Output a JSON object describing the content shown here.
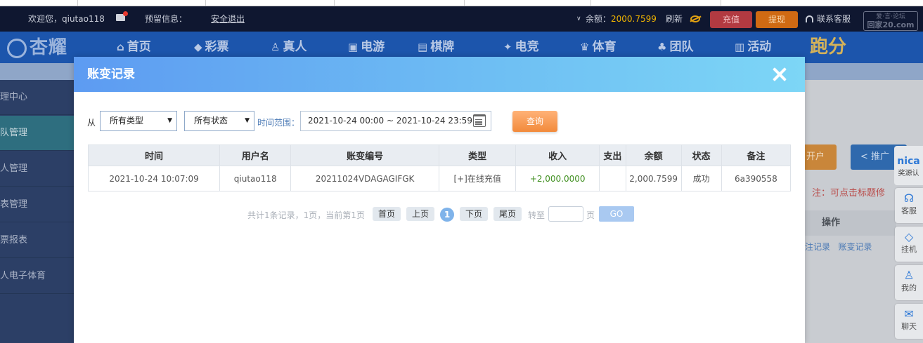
{
  "topbar": {
    "welcome": "欢迎您，qiutao118",
    "notice_label": "预留信息：",
    "logout": "安全退出",
    "balance_label": "余额：",
    "balance_value": "2000.7599",
    "refresh": "刷新",
    "recharge": "充值",
    "withdraw": "提现",
    "support": "联系客服",
    "watermark_line1": "爱·言·论坛",
    "watermark_line2": "回家20.com"
  },
  "brand": {
    "logo": "杏耀"
  },
  "nav": {
    "items": [
      {
        "icon": "home-icon",
        "glyph": "⌂",
        "label": "首页"
      },
      {
        "icon": "lottery-icon",
        "glyph": "◆",
        "label": "彩票"
      },
      {
        "icon": "live-icon",
        "glyph": "♙",
        "label": "真人"
      },
      {
        "icon": "slot-icon",
        "glyph": "▣",
        "label": "电游"
      },
      {
        "icon": "chess-icon",
        "glyph": "▤",
        "label": "棋牌"
      },
      {
        "icon": "esports-icon",
        "glyph": "✦",
        "label": "电竞"
      },
      {
        "icon": "sports-icon",
        "glyph": "♛",
        "label": "体育"
      },
      {
        "icon": "team-icon",
        "glyph": "♣",
        "label": "团队"
      },
      {
        "icon": "activity-icon",
        "glyph": "▥",
        "label": "活动"
      }
    ],
    "extra": "跑分"
  },
  "sidebar": {
    "items": [
      {
        "label": "理中心"
      },
      {
        "label": "队管理"
      },
      {
        "label": "人管理"
      },
      {
        "label": "表管理"
      },
      {
        "label": "票报表"
      },
      {
        "label": "人电子体育"
      }
    ]
  },
  "background": {
    "open_account": "开户",
    "promo": "推广",
    "tip": "注：可点击标题修",
    "col_action": "操作",
    "link_bet": "注记录",
    "link_txn": "账变记录"
  },
  "rail": {
    "top_brand": "nica",
    "top_label": "奖源认",
    "items": [
      {
        "icon": "headset-icon",
        "glyph": "☊",
        "label": "客服"
      },
      {
        "icon": "diamond-icon",
        "glyph": "◇",
        "label": "挂机"
      },
      {
        "icon": "user-icon",
        "glyph": "♙",
        "label": "我的"
      },
      {
        "icon": "chat-icon",
        "glyph": "✉",
        "label": "聊天"
      }
    ]
  },
  "modal": {
    "title": "账变记录",
    "filter": {
      "from_label": "从",
      "type_value": "所有类型",
      "status_value": "所有状态",
      "time_label": "时间范围：",
      "date_range": "2021-10-24 00:00 ~ 2021-10-24 23:59",
      "query": "查询"
    },
    "table": {
      "headers": [
        "时间",
        "用户名",
        "账变编号",
        "类型",
        "收入",
        "支出",
        "余额",
        "状态",
        "备注"
      ],
      "rows": [
        [
          "2021-10-24 10:07:09",
          "qiutao118",
          "20211024VDAGAGIFGK",
          "[+]在线充值",
          "+2,000.0000",
          "",
          "2,000.7599",
          "成功",
          "6a390558"
        ]
      ]
    },
    "pager": {
      "info": "共计1条记录，1页，当前第1页",
      "first": "首页",
      "prev": "上页",
      "current": "1",
      "next": "下页",
      "last": "尾页",
      "goto_label": "转至",
      "page_label": "页",
      "go": "GO"
    }
  },
  "colors": {
    "topbar_bg": "#0f1730",
    "nav_bg": "#1c55ac",
    "modal_header_start": "#5d9bf2",
    "modal_header_end": "#7dd6f6",
    "query_button": "#f28a3b",
    "income_green": "#3f8f1f"
  }
}
